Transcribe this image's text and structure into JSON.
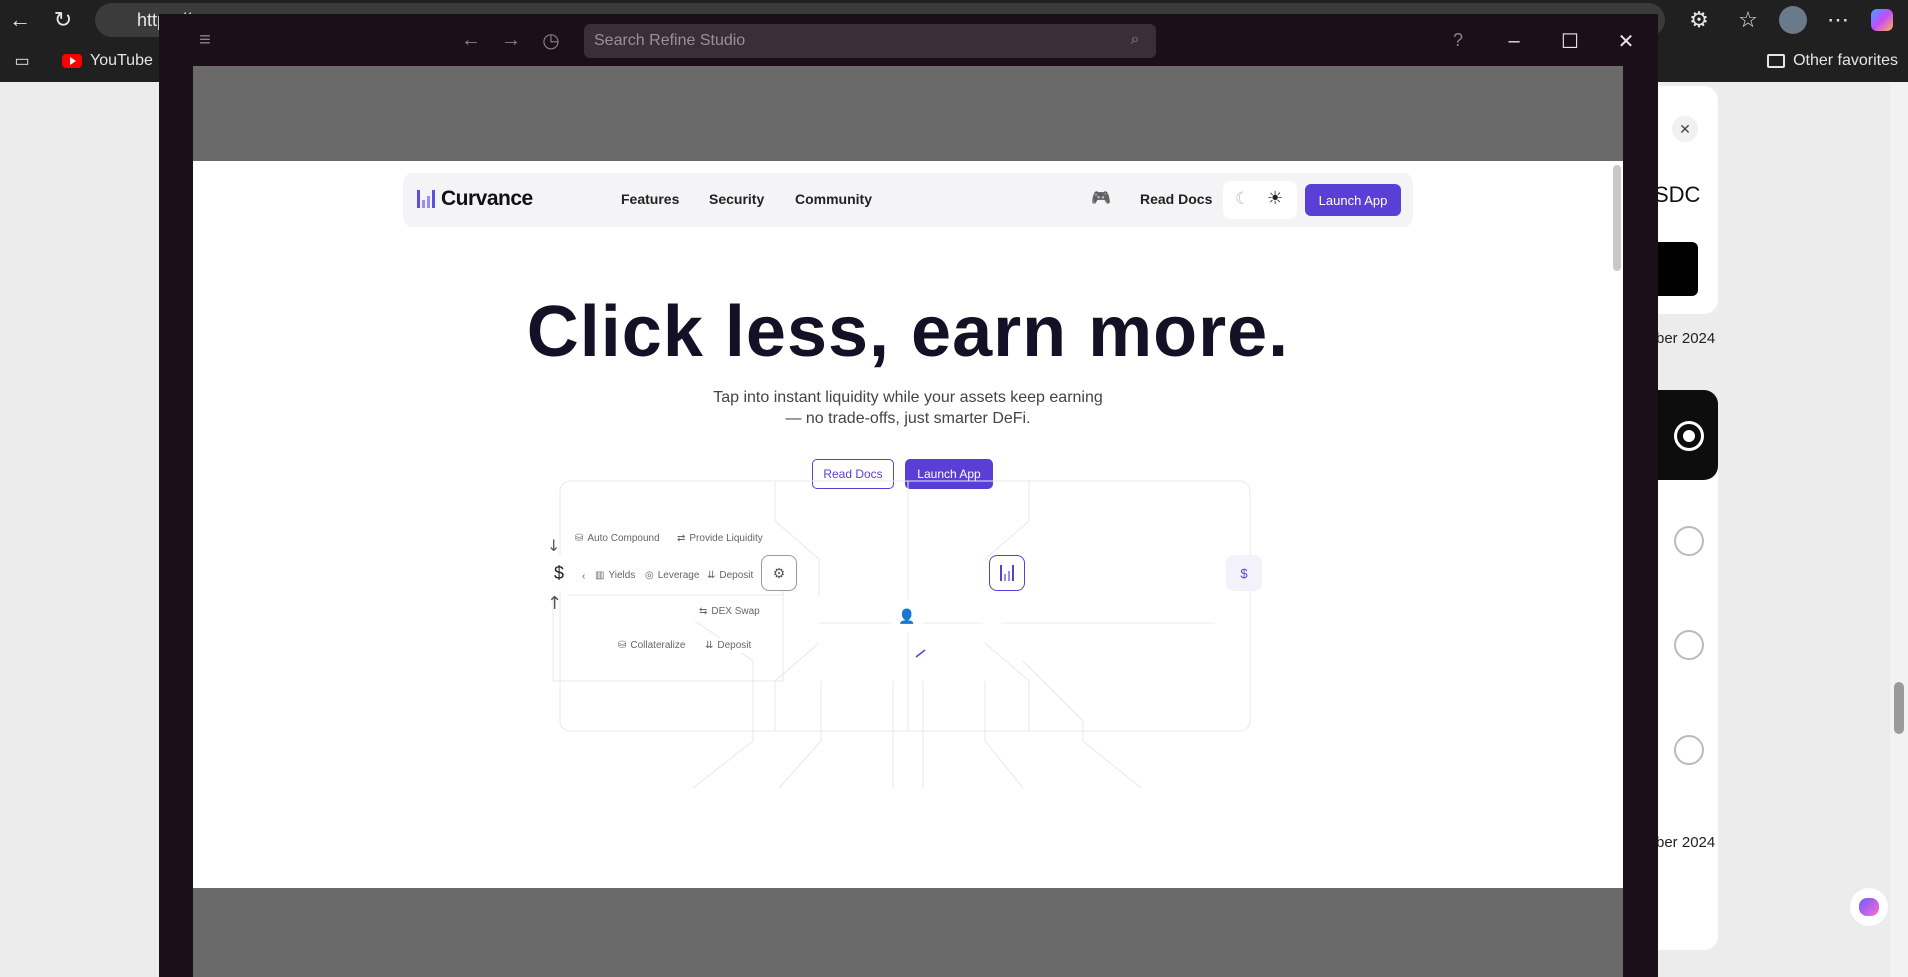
{
  "browser": {
    "url": "https://...",
    "bookmarks": {
      "youtube": "YouTube",
      "other": "Other favorites"
    }
  },
  "app": {
    "search_placeholder": "Search Refine Studio"
  },
  "right_panel": {
    "fragment_sdc": "SDC",
    "date_1": "ber 2024",
    "date_2": "ber 2024"
  },
  "site": {
    "brand": "Curvance",
    "nav": {
      "features": "Features",
      "security": "Security",
      "community": "Community",
      "read_docs": "Read Docs",
      "launch_app": "Launch App"
    },
    "hero": {
      "title": "Click less, earn more.",
      "subtitle": "Tap into instant liquidity while your assets keep earning — no trade-offs, just smarter DeFi.",
      "btn_docs": "Read Docs",
      "btn_launch": "Launch App"
    },
    "diagram": {
      "auto_compound": "Auto Compound",
      "provide_liquidity": "Provide Liquidity",
      "yields": "Yields",
      "leverage": "Leverage",
      "deposit": "Deposit",
      "dex_swap": "DEX Swap",
      "collateralize": "Collateralize",
      "deposit2": "Deposit",
      "dollar": "$",
      "dollar2": "$"
    }
  },
  "colors": {
    "accent": "#5a3fd6",
    "title": "#141126",
    "app_bg": "#1b0f19"
  }
}
